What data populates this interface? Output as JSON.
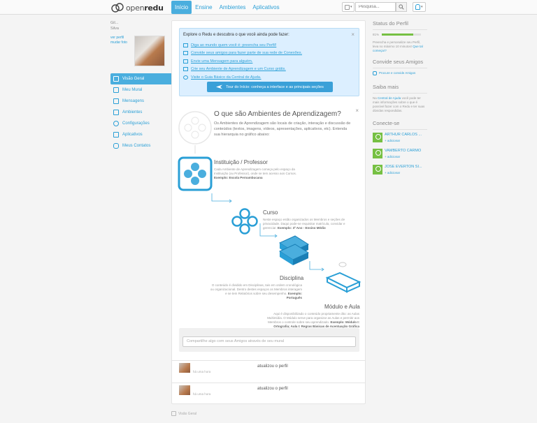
{
  "brand": {
    "logo_text_light": "open",
    "logo_text_bold": "redu"
  },
  "nav": {
    "tabs": [
      {
        "label": "Início",
        "active": true
      },
      {
        "label": "Ensine",
        "active": false
      },
      {
        "label": "Ambientes",
        "active": false
      },
      {
        "label": "Aplicativos",
        "active": false
      }
    ]
  },
  "search": {
    "placeholder": "Pesquisa..."
  },
  "user": {
    "name_line1": "Gil...",
    "name_line2": "Silva",
    "view_profile": "ver perfil",
    "change_photo": "mudar foto"
  },
  "sidebar": {
    "items": [
      {
        "label": "Visão Geral",
        "icon": "home-icon",
        "active": true
      },
      {
        "label": "Meu Mural",
        "icon": "wall-icon",
        "active": false
      },
      {
        "label": "Mensagens",
        "icon": "mail-icon",
        "active": false
      },
      {
        "label": "Ambientes",
        "icon": "grid-icon",
        "active": false
      },
      {
        "label": "Configurações",
        "icon": "gear-icon",
        "active": false
      },
      {
        "label": "Aplicativos",
        "icon": "apps-icon",
        "active": false
      },
      {
        "label": "Meus Contatos",
        "icon": "contacts-icon",
        "active": false
      }
    ]
  },
  "explore": {
    "title": "Explore o Redu e descubra o que você ainda pode fazer:",
    "items": [
      "Diga ao mundo quem você é: preencha seu Perfil!",
      "Convide seus amigos para fazer parte de sua rede de Conexões.",
      "Envie uma Mensagem para alguém.",
      "Crie seu Ambiente de Aprendizagem e um Curso grátis.",
      "Visite o Guia Básico da Central de Ajuda."
    ],
    "tour_button": "Tour do Início: conheça a interface e as principais seções"
  },
  "info": {
    "title": "O que são Ambientes de Aprendizagem?",
    "description": "Os Ambientes de Aprendizagem são locais de criação, interação e discussão de conteúdos (textos, imagens, vídeos, apresentações, aplicativos, etc). Entenda sua hierarquia no gráfico abaixo:",
    "levels": [
      {
        "title": "Instituição / Professor",
        "text": "Cada Ambiente de Aprendizagem começa pelo espaço da Instituição (ou Professor), onde se tem acesso aos Cursos.",
        "example_label": "Exemplo:",
        "example": "Escola Pernambucana"
      },
      {
        "title": "Curso",
        "text": "Neste espaço estão organizados os Membros e seções de privacidade. Daqui pode-se requisitar matrícula, convidar e gerenciar.",
        "example_label": "Exemplo:",
        "example": "3º Ano - Ensino Médio"
      },
      {
        "title": "Disciplina",
        "text": "O conteúdo é dividido em Disciplinas, tais em ordem cronológica ou organizacional. Dentro destes espaços os Membros interagem e se tem Relatórios sobre seu desempenho.",
        "example_label": "Exemplo:",
        "example": "Português"
      },
      {
        "title": "Módulo e Aula",
        "text": "Aqui é disponibilizado o conteúdo propriamente dito: as Aulas Multimídia. O Módulo serve para organizar as Aulas e permitir aos Membros o controle sobre seu aprendizado.",
        "example_label": "Exemplo:",
        "example": "Módulo I: Ortografia; Aula I: Regras Básicas de Acentuação Gráfica"
      }
    ]
  },
  "share": {
    "placeholder": "Compartilhe algo com seus Amigos através de seu mural"
  },
  "feed": [
    {
      "text": "atualizou o perfil",
      "time": "há uma hora"
    },
    {
      "text": "atualizou o perfil",
      "time": "há uma hora"
    }
  ],
  "footer": {
    "label": "Visão Geral"
  },
  "right": {
    "profile_status": {
      "title": "Status do Perfil",
      "percent_label": "81%",
      "percent": 0.81,
      "text": "Preencha e personalize seu Perfil, leva no máximo 10 minutos!",
      "link": "Que tal começar?"
    },
    "invite": {
      "title": "Convide seus Amigos",
      "link": "Procure e convide Amigos"
    },
    "learn_more": {
      "title": "Saiba mais",
      "text_pre": "Na",
      "link": "Central de Ajuda",
      "text_post": "você pode ter mais informações sobre o que é possível fazer com o Redu e ter suas dúvidas respondidas."
    },
    "connect": {
      "title": "Conecte-se",
      "add_label": "+ adicionar",
      "people": [
        "ARTHUR CARLOS ...",
        "VAMBERTO CARMO",
        "JOSE EVERTON SI..."
      ]
    }
  },
  "colors": {
    "accent": "#4aaede",
    "link": "#2a9fd6",
    "progress": "#76c043"
  }
}
